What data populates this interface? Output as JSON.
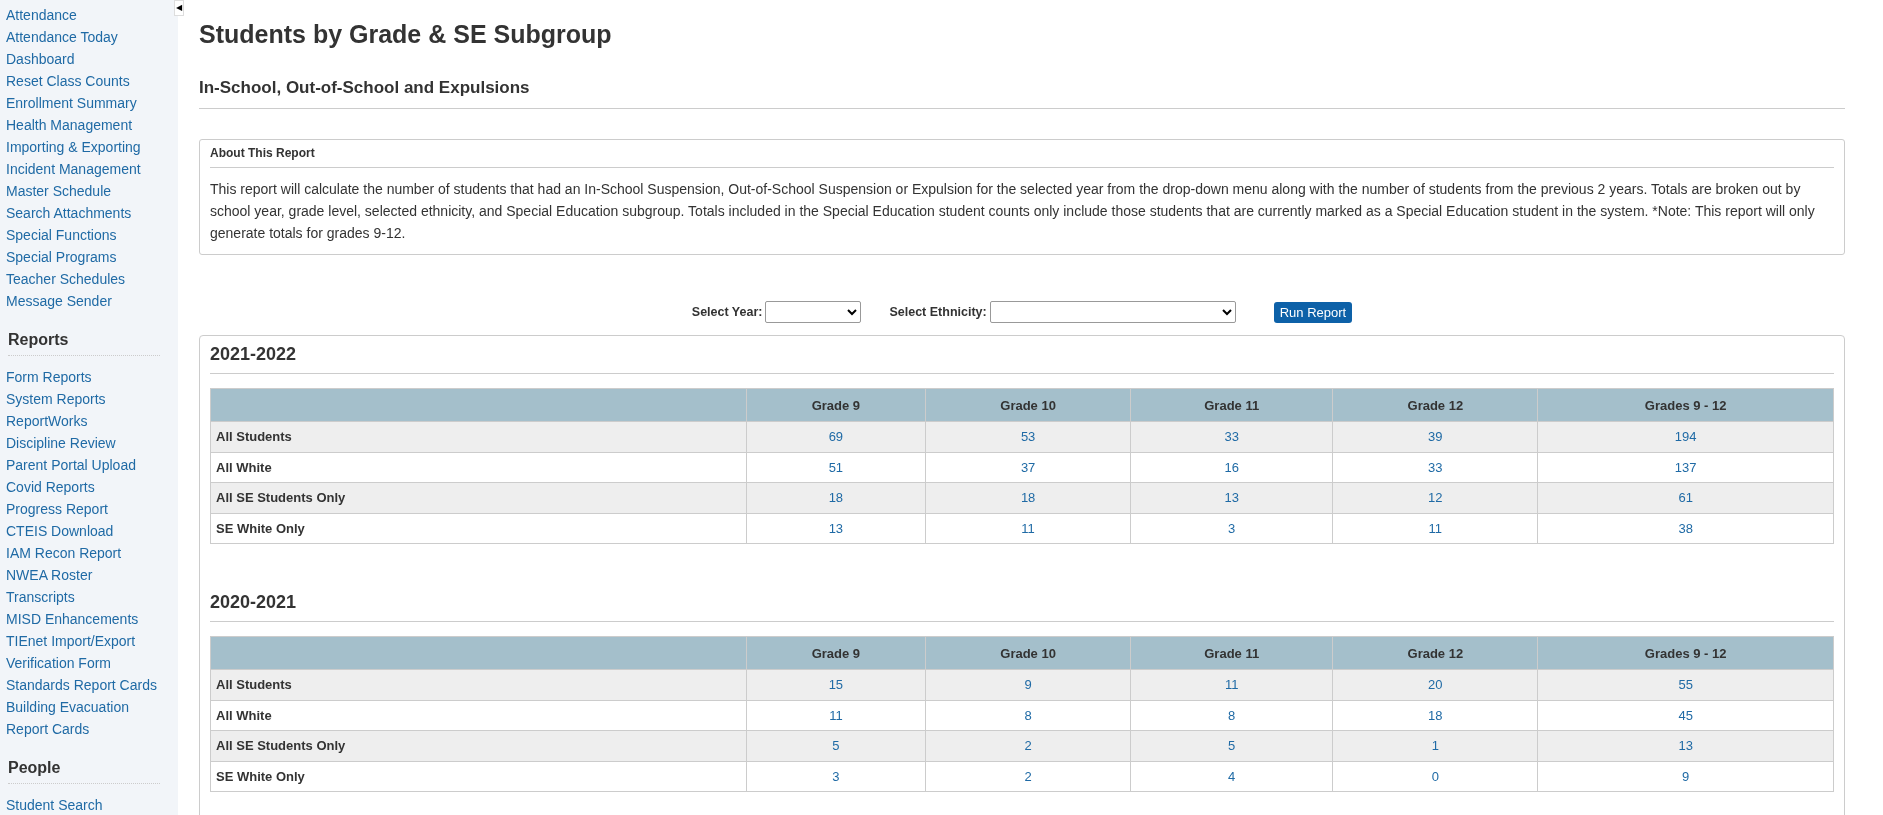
{
  "sidebar": {
    "collapse_glyph": "◀",
    "sections": [
      {
        "items": [
          "Attendance",
          "Attendance Today",
          "Dashboard",
          "Reset Class Counts",
          "Enrollment Summary",
          "Health Management",
          "Importing & Exporting",
          "Incident Management",
          "Master Schedule",
          "Search Attachments",
          "Special Functions",
          "Special Programs",
          "Teacher Schedules",
          "Message Sender"
        ]
      },
      {
        "heading": "Reports",
        "items": [
          "Form Reports",
          "System Reports",
          "ReportWorks",
          "Discipline Review",
          "Parent Portal Upload",
          "Covid Reports",
          "Progress Report",
          "CTEIS Download",
          "IAM Recon Report",
          "NWEA Roster",
          "Transcripts",
          "MISD Enhancements",
          "TIEnet Import/Export",
          "Verification Form",
          "Standards Report Cards",
          "Building Evacuation",
          "Report Cards"
        ]
      },
      {
        "heading": "People",
        "items": [
          "Student Search"
        ]
      }
    ]
  },
  "page": {
    "title": "Students by Grade & SE Subgroup",
    "subtitle": "In-School, Out-of-School and Expulsions",
    "about": {
      "heading": "About This Report",
      "text": "This report will calculate the number of students that had an In-School Suspension, Out-of-School Suspension or Expulsion for the selected year from the drop-down menu along with the number of students from the previous 2 years. Totals are broken out by school year, grade level, selected ethnicity, and Special Education subgroup. Totals included in the Special Education student counts only include those students that are currently marked as a Special Education student in the system. *Note: This report will only generate totals for grades 9-12."
    },
    "filters": [
      {
        "label": "Select Year:"
      },
      {
        "label": "Select Ethnicity:"
      }
    ],
    "run_button": "Run Report",
    "years": [
      {
        "year": "2021-2022",
        "columns": [
          "Grade 9",
          "Grade 10",
          "Grade 11",
          "Grade 12",
          "Grades 9 - 12"
        ],
        "rows": [
          {
            "label": "All Students",
            "values": [
              "69",
              "53",
              "33",
              "39",
              "194"
            ]
          },
          {
            "label": "All White",
            "values": [
              "51",
              "37",
              "16",
              "33",
              "137"
            ]
          },
          {
            "label": "All SE Students Only",
            "values": [
              "18",
              "18",
              "13",
              "12",
              "61"
            ]
          },
          {
            "label": "SE White Only",
            "values": [
              "13",
              "11",
              "3",
              "11",
              "38"
            ]
          }
        ]
      },
      {
        "year": "2020-2021",
        "columns": [
          "Grade 9",
          "Grade 10",
          "Grade 11",
          "Grade 12",
          "Grades 9 - 12"
        ],
        "rows": [
          {
            "label": "All Students",
            "values": [
              "15",
              "9",
              "11",
              "20",
              "55"
            ]
          },
          {
            "label": "All White",
            "values": [
              "11",
              "8",
              "8",
              "18",
              "45"
            ]
          },
          {
            "label": "All SE Students Only",
            "values": [
              "5",
              "2",
              "5",
              "1",
              "13"
            ]
          },
          {
            "label": "SE White Only",
            "values": [
              "3",
              "2",
              "4",
              "0",
              "9"
            ]
          }
        ]
      }
    ]
  }
}
